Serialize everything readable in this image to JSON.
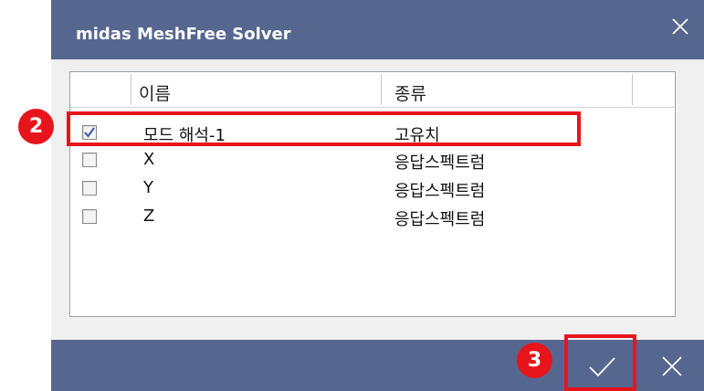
{
  "window": {
    "title": "midas MeshFree Solver"
  },
  "list": {
    "columns": [
      "이름",
      "종류"
    ],
    "rows": [
      {
        "name": "모드 해석-1",
        "type": "고유치",
        "checked": true
      },
      {
        "name": "X",
        "type": "응답스펙트럼",
        "checked": false
      },
      {
        "name": "Y",
        "type": "응답스펙트럼",
        "checked": false
      },
      {
        "name": "Z",
        "type": "응답스펙트럼",
        "checked": false
      }
    ]
  },
  "annotations": {
    "step_2": "2",
    "step_3": "3"
  },
  "colors": {
    "titlebar": "#56678f",
    "highlight": "#e8141b",
    "dialog_bg": "#f0f0f0"
  },
  "icons": {
    "close": "close-icon",
    "ok": "checkmark-icon",
    "cancel": "close-icon"
  }
}
